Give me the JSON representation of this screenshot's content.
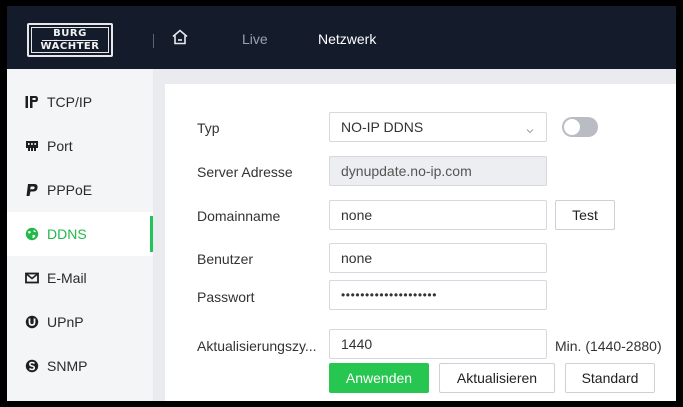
{
  "header": {
    "logo_line1": "BURG",
    "logo_line2": "WÄCHTER",
    "home_icon": "home-icon",
    "nav": [
      {
        "label": "Live",
        "active": false
      },
      {
        "label": "Netzwerk",
        "active": true
      }
    ],
    "background": "#141c2c"
  },
  "sidebar": {
    "items": [
      {
        "label": "TCP/IP",
        "icon": "ip-icon",
        "active": false
      },
      {
        "label": "Port",
        "icon": "port-icon",
        "active": false
      },
      {
        "label": "PPPoE",
        "icon": "pppoe-icon",
        "active": false
      },
      {
        "label": "DDNS",
        "icon": "globe-icon",
        "active": true
      },
      {
        "label": "E-Mail",
        "icon": "mail-icon",
        "active": false
      },
      {
        "label": "UPnP",
        "icon": "upnp-icon",
        "active": false
      },
      {
        "label": "SNMP",
        "icon": "snmp-icon",
        "active": false
      }
    ],
    "accent": "#22c45a"
  },
  "form": {
    "type": {
      "label": "Typ",
      "value": "NO-IP DDNS",
      "enabled": false
    },
    "server": {
      "label": "Server Adresse",
      "value": "dynupdate.no-ip.com"
    },
    "domain": {
      "label": "Domainname",
      "value": "none",
      "test_label": "Test"
    },
    "user": {
      "label": "Benutzer",
      "value": "none"
    },
    "password": {
      "label": "Passwort",
      "value": "••••••••••••••••••••"
    },
    "interval": {
      "label": "Aktualisierungszy...",
      "value": "1440",
      "hint": "Min. (1440-2880)"
    },
    "buttons": {
      "apply": "Anwenden",
      "refresh": "Aktualisieren",
      "default": "Standard"
    }
  }
}
